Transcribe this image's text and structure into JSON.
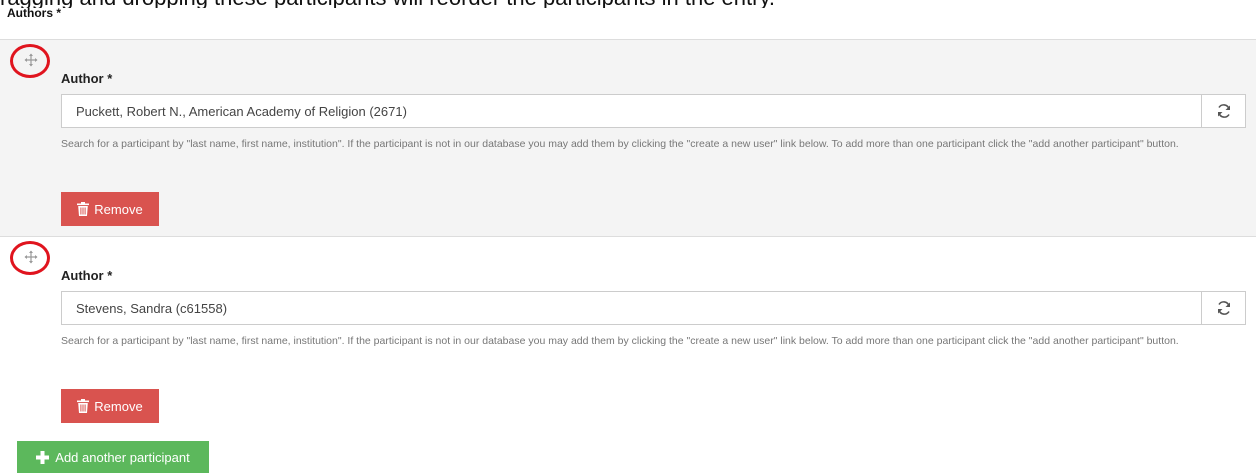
{
  "caption": "ragging and dropping these participants will reorder the participants in the entry.",
  "section": {
    "label": "Authors *"
  },
  "authors": [
    {
      "label": "Author *",
      "value": "Puckett, Robert N., American Academy of Religion (2671)",
      "help": "Search for a participant by \"last name, first name, institution\". If the participant is not in our database you may add them by clicking the \"create a new user\" link below. To add more than one participant click the \"add another participant\" button.",
      "remove_label": "Remove"
    },
    {
      "label": "Author *",
      "value": "Stevens, Sandra (c61558)",
      "help": "Search for a participant by \"last name, first name, institution\". If the participant is not in our database you may add them by clicking the \"create a new user\" link below. To add more than one participant click the \"add another participant\" button.",
      "remove_label": "Remove"
    }
  ],
  "add_button": {
    "label": "Add another participant"
  },
  "colors": {
    "remove": "#d9534f",
    "add": "#5cb85c",
    "annotation": "#e0141e",
    "row_background": "#f4f4f4"
  },
  "icons": {
    "drag": "move-handle-icon",
    "refresh": "refresh-icon",
    "remove": "trash-icon",
    "add": "plus-icon"
  }
}
